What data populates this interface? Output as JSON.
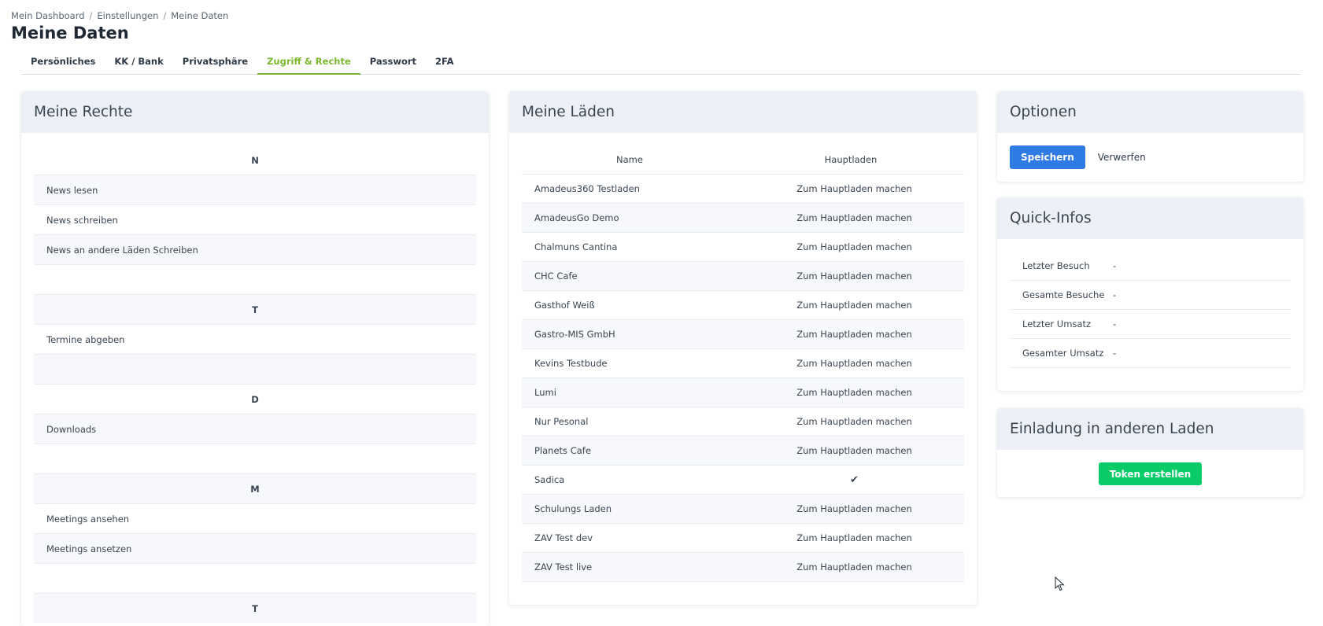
{
  "breadcrumb": [
    "Mein Dashboard",
    "Einstellungen",
    "Meine Daten"
  ],
  "page_title": "Meine Daten",
  "tabs": [
    {
      "label": "Persönliches",
      "active": false
    },
    {
      "label": "KK / Bank",
      "active": false
    },
    {
      "label": "Privatsphäre",
      "active": false
    },
    {
      "label": "Zugriff & Rechte",
      "active": true
    },
    {
      "label": "Passwort",
      "active": false
    },
    {
      "label": "2FA",
      "active": false
    }
  ],
  "rights": {
    "title": "Meine Rechte",
    "groups": [
      {
        "letter": "N",
        "items": [
          "News lesen",
          "News schreiben",
          "News an andere Läden Schreiben"
        ]
      },
      {
        "letter": "T",
        "items": [
          "Termine abgeben"
        ]
      },
      {
        "letter": "D",
        "items": [
          "Downloads"
        ]
      },
      {
        "letter": "M",
        "items": [
          "Meetings ansehen",
          "Meetings ansetzen"
        ]
      },
      {
        "letter": "T",
        "items": []
      }
    ]
  },
  "stores": {
    "title": "Meine Läden",
    "col_name": "Name",
    "col_main": "Hauptladen",
    "action_label": "Zum Hauptladen machen",
    "rows": [
      {
        "name": "Amadeus360 Testladen",
        "main": false
      },
      {
        "name": "AmadeusGo Demo",
        "main": false
      },
      {
        "name": "Chalmuns Cantina",
        "main": false
      },
      {
        "name": "CHC Cafe",
        "main": false
      },
      {
        "name": "Gasthof Weiß",
        "main": false
      },
      {
        "name": "Gastro-MIS GmbH",
        "main": false
      },
      {
        "name": "Kevins Testbude",
        "main": false
      },
      {
        "name": "Lumi",
        "main": false
      },
      {
        "name": "Nur Pesonal",
        "main": false
      },
      {
        "name": "Planets Cafe",
        "main": false
      },
      {
        "name": "Sadica",
        "main": true
      },
      {
        "name": "Schulungs Laden",
        "main": false
      },
      {
        "name": "ZAV Test dev",
        "main": false
      },
      {
        "name": "ZAV Test live",
        "main": false
      }
    ]
  },
  "options": {
    "title": "Optionen",
    "save_label": "Speichern",
    "discard_label": "Verwerfen"
  },
  "quick_infos": {
    "title": "Quick-Infos",
    "rows": [
      {
        "label": "Letzter Besuch",
        "value": "-"
      },
      {
        "label": "Gesamte Besuche",
        "value": "-"
      },
      {
        "label": "Letzter Umsatz",
        "value": "-"
      },
      {
        "label": "Gesamter Umsatz",
        "value": "-"
      }
    ]
  },
  "invite": {
    "title": "Einladung in anderen Laden",
    "token_label": "Token erstellen"
  }
}
